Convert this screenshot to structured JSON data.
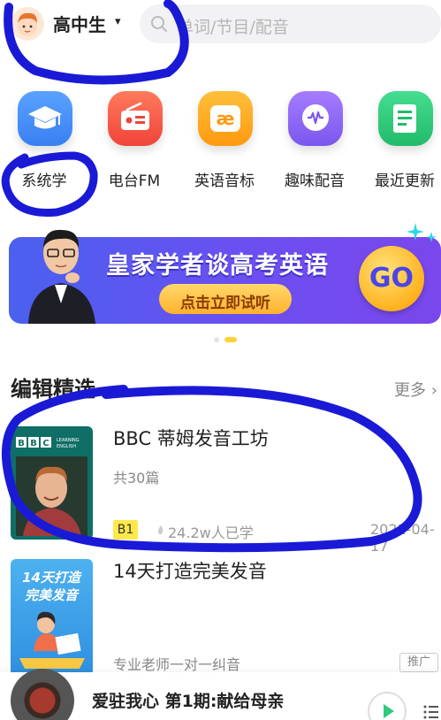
{
  "header": {
    "grade": "高中生",
    "caret": "▾",
    "search_placeholder": "单词/节目/配音"
  },
  "categories": [
    {
      "label": "系统学",
      "icon": "graduation-cap-icon",
      "color": "#3f8cf5"
    },
    {
      "label": "电台FM",
      "icon": "radio-icon",
      "color": "#f35a4a"
    },
    {
      "label": "英语音标",
      "icon": "phonetic-ae-icon",
      "color": "#ffa11f"
    },
    {
      "label": "趣味配音",
      "icon": "soundwave-chat-icon",
      "color": "#8a63f2"
    },
    {
      "label": "最近更新",
      "icon": "document-icon",
      "color": "#2fca7a"
    }
  ],
  "banner": {
    "title": "皇家学者谈高考英语",
    "button": "点击立即试听",
    "go": "GO"
  },
  "carousel": {
    "count": 2,
    "active": 2
  },
  "section": {
    "title": "编辑精选",
    "more": "更多 ›"
  },
  "items": [
    {
      "title": "BBC 蒂姆发音工坊",
      "sub": "共30篇",
      "level": "B1",
      "learners": "24.2w人已学",
      "date": "2021-04-17",
      "thumb_brand": "BBC",
      "thumb_brand_sub": "LEARNING ENGLISH"
    },
    {
      "title": "14天打造完美发音",
      "sub": "专业老师一对一纠音",
      "tag": "推广",
      "thumb_text_1": "14天打造",
      "thumb_text_2": "完美发音"
    }
  ],
  "player": {
    "title": "爱驻我心 第1期:献给母亲"
  },
  "colors": {
    "annotation": "#1a1ad6",
    "accent_yellow": "#ffd43b"
  }
}
